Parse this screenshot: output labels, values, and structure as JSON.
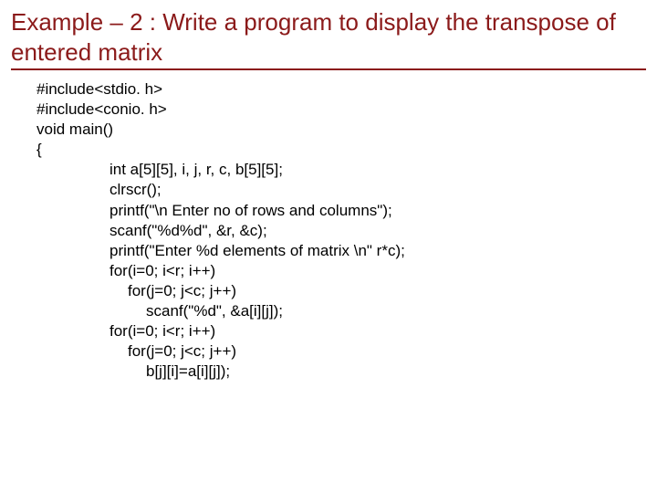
{
  "title": "Example – 2 : Write a program to display the transpose of entered matrix",
  "code": {
    "l1": "#include<stdio. h>",
    "l2": "#include<conio. h>",
    "l3": " void main()",
    "l4": "{",
    "l5": "int a[5][5], i, j, r, c, b[5][5];",
    "l6": "clrscr();",
    "l7": "printf(\"\\n Enter no of rows and columns\");",
    "l8": "scanf(\"%d%d\", &r, &c);",
    "l9": "printf(\"Enter  %d elements of matrix \\n\" r*c);",
    "l10": "for(i=0; i<r; i++)",
    "l11": "for(j=0; j<c; j++)",
    "l12": "scanf(\"%d\", &a[i][j]);",
    "l13": "for(i=0; i<r; i++)",
    "l14": "for(j=0; j<c; j++)",
    "l15": "b[j][i]=a[i][j]);"
  }
}
